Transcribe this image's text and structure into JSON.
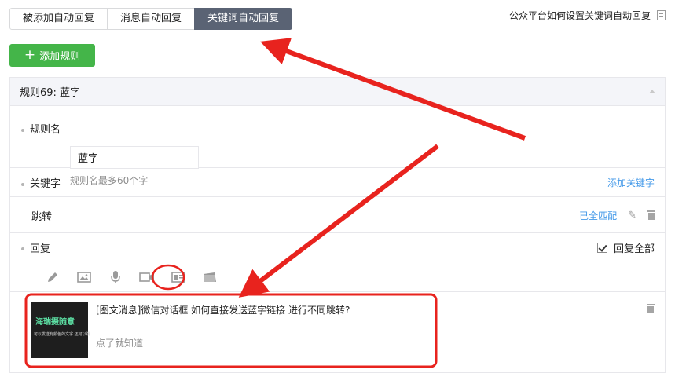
{
  "tabs": [
    {
      "label": "被添加自动回复",
      "active": false
    },
    {
      "label": "消息自动回复",
      "active": false
    },
    {
      "label": "关键词自动回复",
      "active": true
    }
  ],
  "help_link": "公众平台如何设置关键词自动回复",
  "add_rule_button": "添加规则",
  "rule": {
    "header": "规则69: 蓝字",
    "name_label": "规则名",
    "name_value": "蓝字",
    "name_hint": "规则名最多60个字",
    "keyword_label": "关键字",
    "add_keyword_link": "添加关键字",
    "keyword_value": "跳转",
    "match_mode": "已全匹配",
    "reply_label": "回复",
    "reply_all_label": "回复全部",
    "reply_all_checked": true,
    "toolbar_icons": [
      "pencil-icon",
      "image-icon",
      "microphone-icon",
      "video-icon",
      "news-article-icon",
      "card-icon"
    ],
    "reply_item": {
      "title": "[图文消息]微信对话框 如何直接发送蓝字链接 进行不同跳转?",
      "description": "点了就知道",
      "thumb_title": "海瑞摄随意",
      "thumb_subtitle": "可以发送有颜色的文字 还可以跳"
    }
  },
  "colors": {
    "active_tab": "#5a6374",
    "add_button": "#44b549",
    "link": "#459ae9",
    "annotation": "#e8231e"
  }
}
